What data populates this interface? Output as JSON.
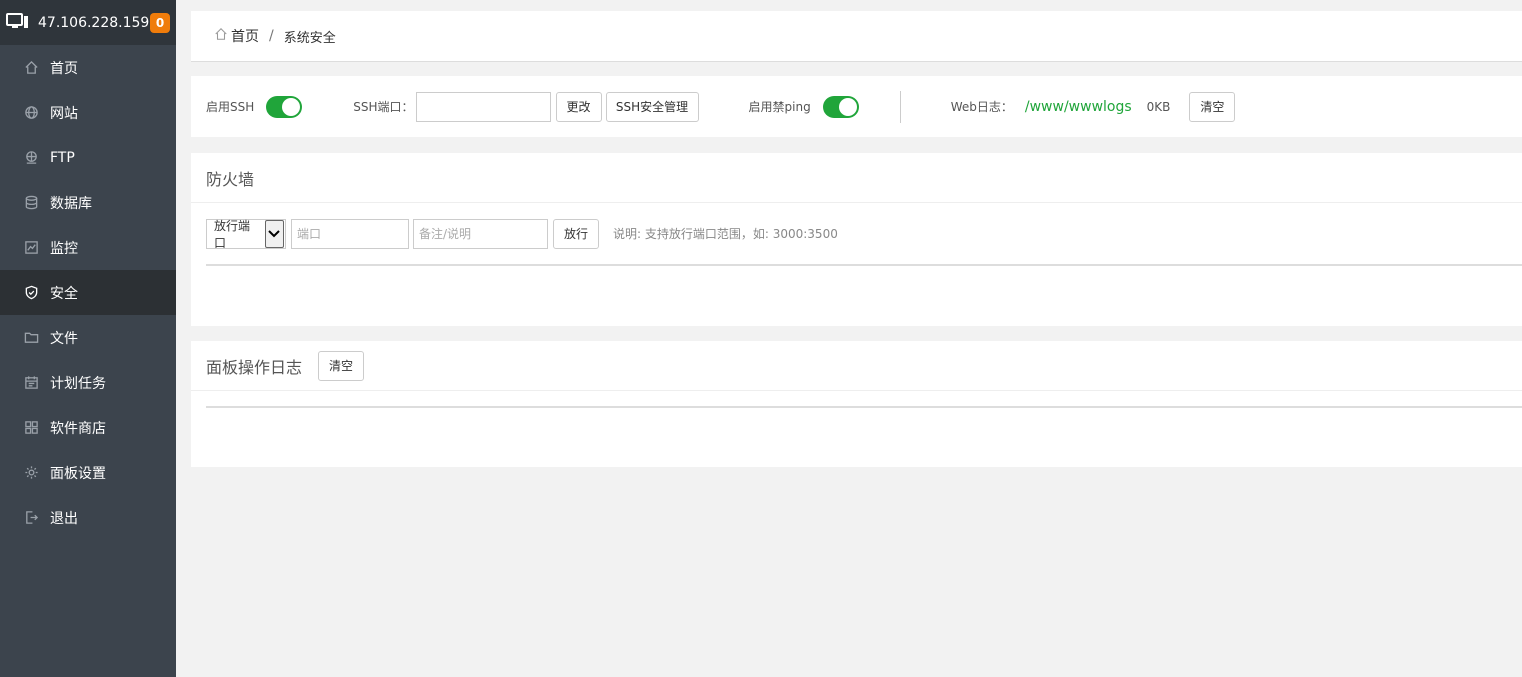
{
  "sidebar": {
    "server_ip": "47.106.228.159",
    "badge_count": "0",
    "items": [
      {
        "label": "首页",
        "icon": "home-icon"
      },
      {
        "label": "网站",
        "icon": "globe-icon"
      },
      {
        "label": "FTP",
        "icon": "ftp-icon"
      },
      {
        "label": "数据库",
        "icon": "database-icon"
      },
      {
        "label": "监控",
        "icon": "monitor-icon"
      },
      {
        "label": "安全",
        "icon": "shield-icon",
        "active": true
      },
      {
        "label": "文件",
        "icon": "folder-icon"
      },
      {
        "label": "计划任务",
        "icon": "calendar-icon"
      },
      {
        "label": "软件商店",
        "icon": "grid-icon"
      },
      {
        "label": "面板设置",
        "icon": "gear-icon"
      },
      {
        "label": "退出",
        "icon": "logout-icon"
      }
    ]
  },
  "breadcrumb": {
    "home": "首页",
    "separator": "/",
    "current": "系统安全"
  },
  "ssh": {
    "enable_label": "启用SSH",
    "enable_state": true,
    "port_label": "SSH端口：",
    "port_value": "",
    "change_button": "更改",
    "manage_button": "SSH安全管理",
    "ping_label": "启用禁ping",
    "ping_state": true,
    "weblog_label": "Web日志：",
    "weblog_path": "/www/wwwlogs",
    "weblog_size": "0KB",
    "clear_button": "清空"
  },
  "firewall": {
    "title": "防火墙",
    "select_value": "放行端口",
    "port_placeholder": "端口",
    "note_placeholder": "备注/说明",
    "allow_button": "放行",
    "hint": "说明: 支持放行端口范围，如: 3000:3500"
  },
  "panel_log": {
    "title": "面板操作日志",
    "clear_button": "清空"
  },
  "colors": {
    "sidebar_bg": "#3c444d",
    "sidebar_header_bg": "#2f353b",
    "accent_green": "#20a53a",
    "badge_orange": "#ef7c0b"
  }
}
